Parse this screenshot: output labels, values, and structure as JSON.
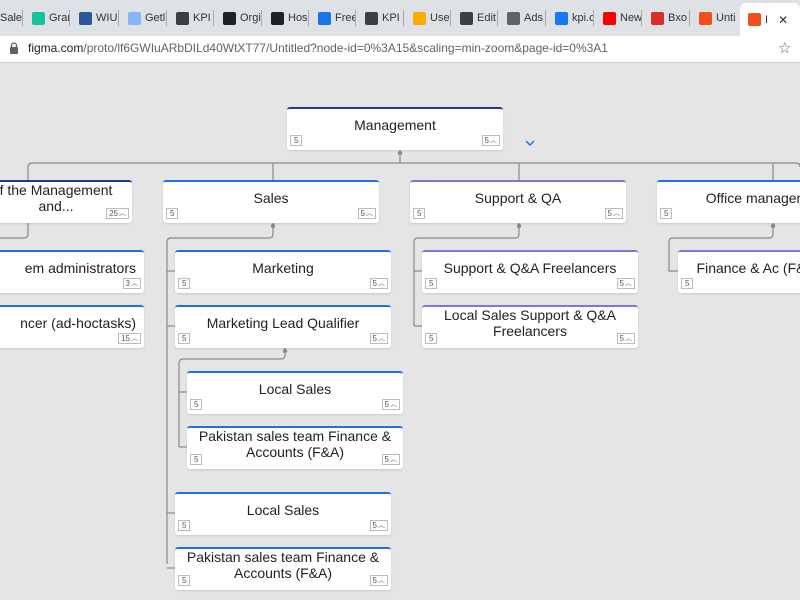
{
  "browser": {
    "tabs": [
      {
        "label": "Sale",
        "icon": "doc-icon",
        "color": "#5f6368"
      },
      {
        "label": "Grar",
        "icon": "grammarly-icon",
        "color": "#15c39a"
      },
      {
        "label": "WIU",
        "icon": "word-icon",
        "color": "#2b579a"
      },
      {
        "label": "Getl",
        "icon": "doc-icon",
        "color": "#8ab4f8"
      },
      {
        "label": "KPI",
        "icon": "kpi-icon",
        "color": "#3c4043"
      },
      {
        "label": "Orgi",
        "icon": "s-icon",
        "color": "#202124"
      },
      {
        "label": "Hos",
        "icon": "github-icon",
        "color": "#202124"
      },
      {
        "label": "Free",
        "icon": "robot-icon",
        "color": "#1a73e8"
      },
      {
        "label": "KPI",
        "icon": "kpi-icon",
        "color": "#3c4043"
      },
      {
        "label": "Use",
        "icon": "folder-icon",
        "color": "#f9ab00"
      },
      {
        "label": "Edit",
        "icon": "kpi-icon",
        "color": "#3c4043"
      },
      {
        "label": "Ads",
        "icon": "ads-icon",
        "color": "#5f6368"
      },
      {
        "label": "kpi.c",
        "icon": "facebook-icon",
        "color": "#1877f2"
      },
      {
        "label": "New",
        "icon": "youtube-icon",
        "color": "#ff0000"
      },
      {
        "label": "Bxo",
        "icon": "gmail-icon",
        "color": "#d93025"
      },
      {
        "label": "Unti",
        "icon": "figma-icon",
        "color": "#f24e1e"
      },
      {
        "label": "I",
        "icon": "figma-icon",
        "color": "#f24e1e"
      }
    ],
    "close_glyph": "✕",
    "url_host": "figma.com",
    "url_path": "/proto/lf6GWIuARbDILd40WtXT77/Untitled?node-id=0%3A15&scaling=min-zoom&page-id=0%3A1",
    "star_glyph": "☆"
  },
  "org_chart": {
    "root": {
      "label": "Management",
      "badge_left": "5",
      "badge_right": "5"
    },
    "departments": [
      {
        "label": "f the Management and...",
        "badge_left": "",
        "badge_right": "25",
        "color": "navy"
      },
      {
        "label": "Sales",
        "badge_left": "5",
        "badge_right": "5",
        "color": "blue"
      },
      {
        "label": "Support & QA",
        "badge_left": "5",
        "badge_right": "5",
        "color": "purple"
      },
      {
        "label": "Office managem",
        "badge_left": "5",
        "badge_right": "",
        "color": "blue"
      }
    ],
    "management_children": [
      {
        "label": "em administrators",
        "badge_left": "",
        "badge_right": "3"
      },
      {
        "label": "ncer (ad-hoctasks)",
        "badge_left": "",
        "badge_right": "15"
      }
    ],
    "sales_children": [
      {
        "label": "Marketing",
        "badge_left": "5",
        "badge_right": "5"
      },
      {
        "label": "Marketing Lead Qualifier",
        "badge_left": "5",
        "badge_right": "5"
      },
      {
        "label": "Local Sales",
        "badge_left": "5",
        "badge_right": "5"
      },
      {
        "label": "Pakistan sales team Finance & Accounts (F&A)",
        "badge_left": "5",
        "badge_right": "5"
      }
    ],
    "qualifier_children": [
      {
        "label": "Local Sales",
        "badge_left": "5",
        "badge_right": "5"
      },
      {
        "label": "Pakistan sales team Finance & Accounts (F&A)",
        "badge_left": "5",
        "badge_right": "5"
      }
    ],
    "support_children": [
      {
        "label": "Support & Q&A Freelancers",
        "badge_left": "5",
        "badge_right": "5"
      },
      {
        "label": "Local Sales Support & Q&A Freelancers",
        "badge_left": "5",
        "badge_right": "5"
      }
    ],
    "office_children": [
      {
        "label": "Finance & Ac (F&A)",
        "badge_left": "5",
        "badge_right": ""
      }
    ],
    "expand_glyph": "⌄"
  }
}
